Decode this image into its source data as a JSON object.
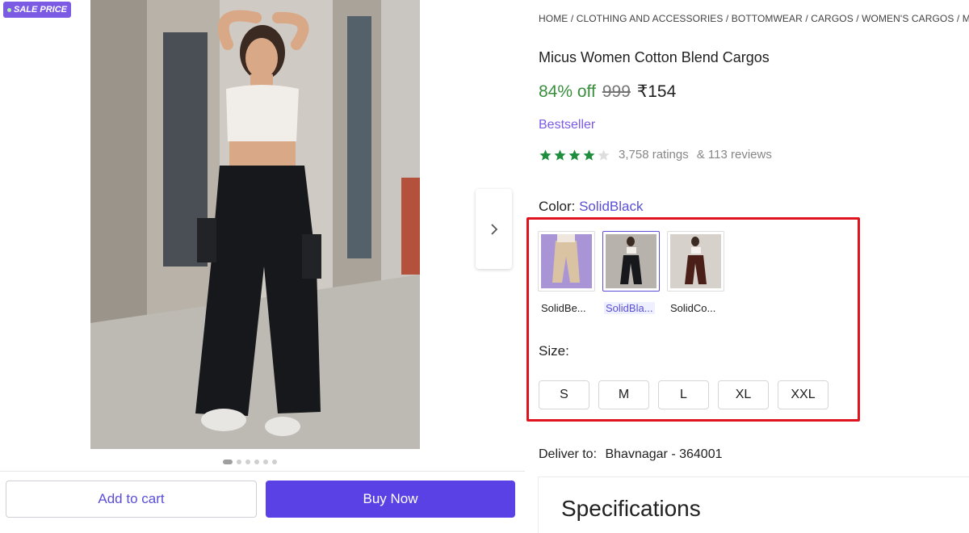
{
  "badge": {
    "text": "SALE PRICE"
  },
  "gallery": {
    "image_count": 6,
    "active_index": 0
  },
  "breadcrumb": "HOME / CLOTHING AND ACCESSORIES / BOTTOMWEAR / CARGOS / WOMEN'S CARGOS / MICUS",
  "product": {
    "title": "Micus Women Cotton Blend Cargos",
    "discount": "84% off",
    "mrp": "999",
    "price": "₹154",
    "tag": "Bestseller",
    "rating_stars": 4,
    "rating_max": 5,
    "ratings": "3,758 ratings",
    "reviews": "& 113 reviews"
  },
  "color": {
    "label": "Color:",
    "selected": "SolidBlack",
    "swatches": [
      {
        "label": "SolidBe...",
        "selected": false
      },
      {
        "label": "SolidBla...",
        "selected": true
      },
      {
        "label": "SolidCo...",
        "selected": false
      }
    ]
  },
  "size": {
    "label": "Size:",
    "options": [
      "S",
      "M",
      "L",
      "XL",
      "XXL"
    ]
  },
  "delivery": {
    "label": "Deliver to:",
    "location": "Bhavnagar - 364001"
  },
  "specifications": {
    "title": "Specifications"
  },
  "actions": {
    "add_to_cart": "Add to cart",
    "buy_now": "Buy Now"
  },
  "colors": {
    "accent": "#5a4fd6",
    "buy_button": "#5a41e6",
    "badge": "#7b5be4",
    "discount_green": "#388e3c",
    "star_green": "#1e8e3e",
    "highlight_red": "#e0141e"
  }
}
